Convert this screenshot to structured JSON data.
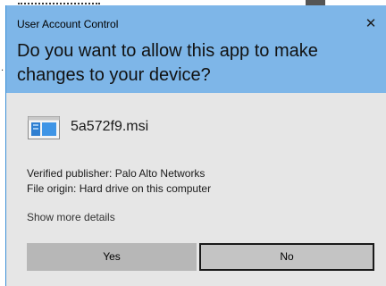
{
  "dialog": {
    "window_title": "User Account Control",
    "close_glyph": "✕",
    "question": "Do you want to allow this app to make changes to your device?",
    "app_icon": "msi-installer-icon",
    "app_name": "5a572f9.msi",
    "publisher_line": "Verified publisher: Palo Alto Networks",
    "origin_line": "File origin: Hard drive on this computer",
    "more_details": "Show more details",
    "buttons": {
      "yes": "Yes",
      "no": "No"
    }
  },
  "colors": {
    "header_bg": "#7eb6e8",
    "body_bg": "#e6e6e6",
    "yes_bg": "#b7b7b7",
    "no_bg": "#c4c4c4",
    "accent_border": "#3c8fd6"
  }
}
